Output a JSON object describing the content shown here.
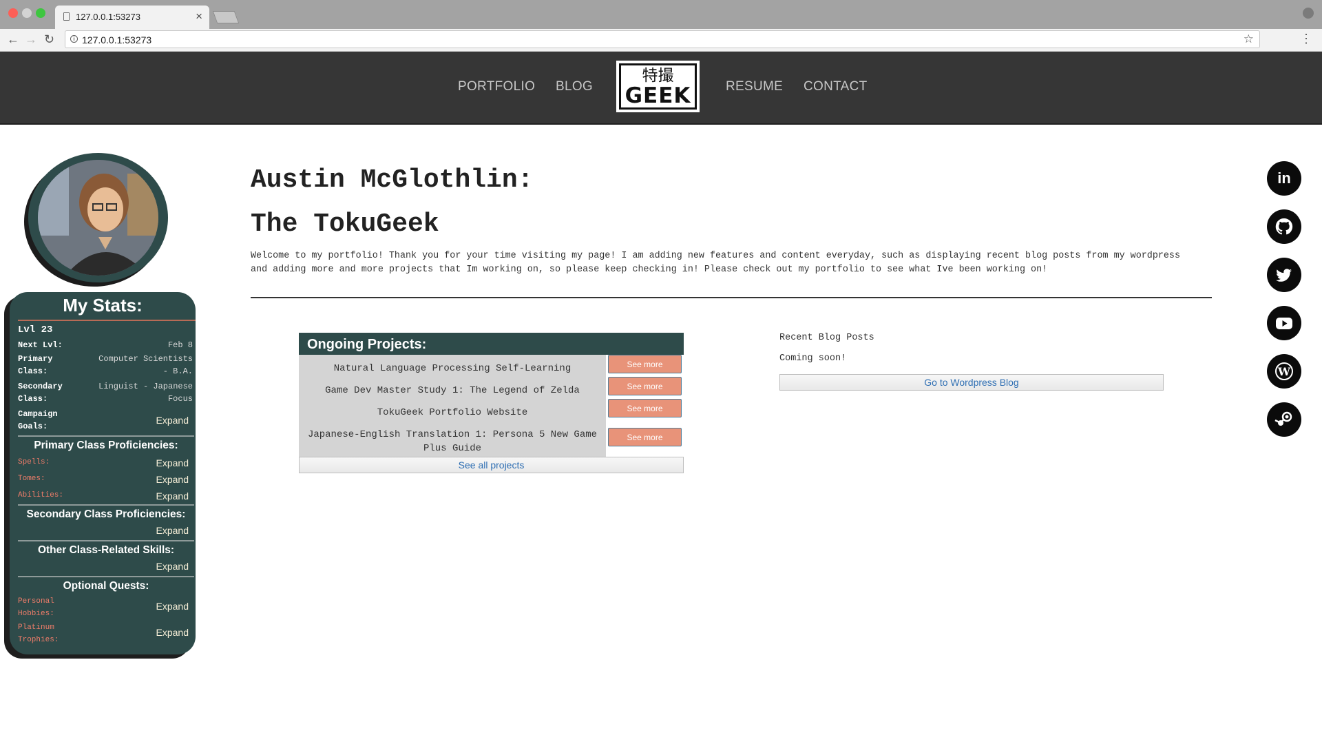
{
  "browser": {
    "tab_title": "127.0.0.1:53273",
    "url": "127.0.0.1:53273"
  },
  "nav": {
    "portfolio": "PORTFOLIO",
    "blog": "BLOG",
    "resume": "RESUME",
    "contact": "CONTACT",
    "logo_kanji": "特撮",
    "logo_word": "GEEK"
  },
  "stats": {
    "title": "My Stats:",
    "lvl": "Lvl 23",
    "next_lvl_label": "Next Lvl:",
    "next_lvl_value": "Feb 8",
    "primary_class_label": "Primary Class:",
    "primary_class_value": "Computer Scientists - B.A.",
    "secondary_class_label": "Secondary Class:",
    "secondary_class_value": "Linguist - Japanese Focus",
    "campaign_goals_label": "Campaign Goals:",
    "expand": "Expand",
    "primary_prof_heading": "Primary Class Proficiencies:",
    "spells": "Spells:",
    "tomes": "Tomes:",
    "abilities": "Abilities:",
    "secondary_prof_heading": "Secondary Class Proficiencies:",
    "other_skills_heading": "Other Class-Related Skills:",
    "optional_quests_heading": "Optional Quests:",
    "personal_hobbies": "Personal Hobbies:",
    "platinum_trophies": "Platinum Trophies:"
  },
  "main": {
    "title_line1": "Austin McGlothlin:",
    "title_line2": "The TokuGeek",
    "intro": "Welcome to my portfolio! Thank you for your time visiting my page! I am adding new features and content everyday, such as displaying recent blog posts from my wordpress and adding more and more projects that Im working on, so please keep checking in! Please check out my portfolio to see what Ive been working on!"
  },
  "projects": {
    "heading": "Ongoing Projects:",
    "items": [
      {
        "name": "Natural Language Processing Self-Learning",
        "button": "See more"
      },
      {
        "name": "Game Dev Master Study 1: The Legend of Zelda",
        "button": "See more"
      },
      {
        "name": "TokuGeek Portfolio Website",
        "button": "See more"
      },
      {
        "name": "Japanese-English Translation 1: Persona 5 New Game Plus Guide",
        "button": "See more"
      }
    ],
    "see_all": "See all projects"
  },
  "blog": {
    "heading": "Recent Blog Posts",
    "status": "Coming soon!",
    "button": "Go to Wordpress Blog"
  },
  "social": {
    "linkedin_label": "in",
    "icons": [
      "linkedin-icon",
      "github-icon",
      "twitter-icon",
      "youtube-icon",
      "wordpress-icon",
      "steam-icon"
    ]
  }
}
